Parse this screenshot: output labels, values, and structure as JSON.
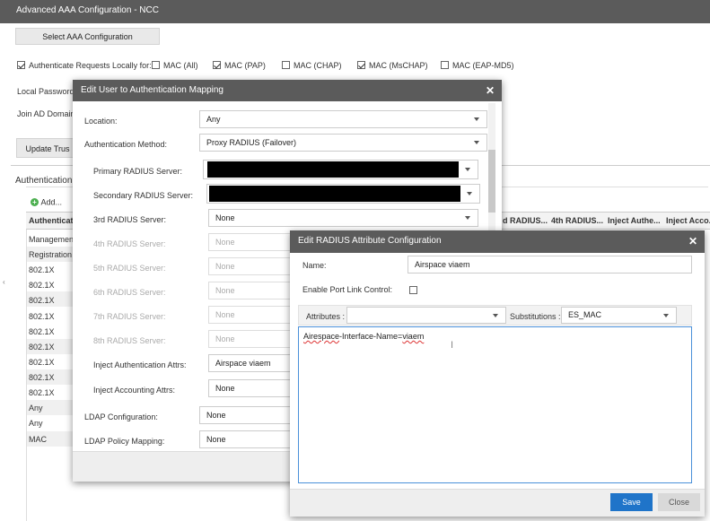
{
  "window": {
    "title": "Advanced AAA Configuration - NCC"
  },
  "select_button": "Select AAA Configuration",
  "auth_locally": {
    "label": "Authenticate Requests Locally for:",
    "options": [
      {
        "label": "MAC (All)",
        "checked": false
      },
      {
        "label": "MAC (PAP)",
        "checked": true
      },
      {
        "label": "MAC (CHAP)",
        "checked": false
      },
      {
        "label": "MAC (MsCHAP)",
        "checked": true
      },
      {
        "label": "MAC (EAP-MD5)",
        "checked": false
      }
    ]
  },
  "bg": {
    "local_password": "Local Password",
    "join_ad": "Join AD Domain",
    "update_trust": "Update Trus",
    "authentication": "Authentication",
    "add": "Add...",
    "col_auth": "Authenticat",
    "rows": [
      "Managemen",
      "Registration",
      "802.1X",
      "802.1X",
      "802.1X",
      "802.1X",
      "802.1X",
      "802.1X",
      "802.1X",
      "802.1X",
      "802.1X",
      "Any",
      "Any",
      "MAC"
    ],
    "right_cols": [
      "d RADIUS...",
      "4th RADIUS...",
      "Inject Authe...",
      "Inject Acco..."
    ]
  },
  "mapping": {
    "title": "Edit User to Authentication Mapping",
    "location_label": "Location:",
    "location_value": "Any",
    "method_label": "Authentication Method:",
    "method_value": "Proxy RADIUS (Failover)",
    "primary_label": "Primary RADIUS Server:",
    "secondary_label": "Secondary RADIUS Server:",
    "third_label": "3rd RADIUS Server:",
    "third_value": "None",
    "fourth_label": "4th RADIUS Server:",
    "fourth_value": "None",
    "fifth_label": "5th RADIUS Server:",
    "fifth_value": "None",
    "sixth_label": "6th RADIUS Server:",
    "sixth_value": "None",
    "seventh_label": "7th RADIUS Server:",
    "seventh_value": "None",
    "eighth_label": "8th RADIUS Server:",
    "eighth_value": "None",
    "inj_auth_label": "Inject Authentication Attrs:",
    "inj_auth_value": "Airspace viaem",
    "inj_acct_label": "Inject Accounting Attrs:",
    "inj_acct_value": "None",
    "ldap_cfg_label": "LDAP Configuration:",
    "ldap_cfg_value": "None",
    "ldap_pol_label": "LDAP Policy Mapping:",
    "ldap_pol_value": "None"
  },
  "radius": {
    "title": "Edit RADIUS Attribute Configuration",
    "name_label": "Name:",
    "name_value": "Airspace viaem",
    "port_link_label": "Enable Port Link Control:",
    "attributes_label": "Attributes :",
    "attributes_value": "",
    "subs_label": "Substitutions :",
    "subs_value": "ES_MAC",
    "text_part1": "Airespace",
    "text_part2": "-Interface-Name=",
    "text_part3": "viaem",
    "save": "Save",
    "close": "Close"
  }
}
